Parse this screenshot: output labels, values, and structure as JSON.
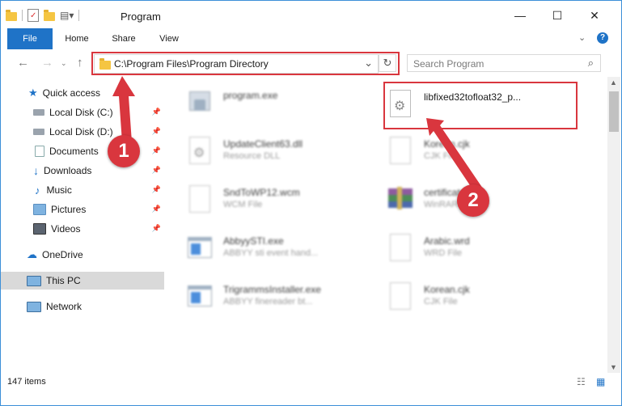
{
  "window": {
    "title": "Program"
  },
  "ribbon": {
    "tabs": [
      "File",
      "Home",
      "Share",
      "View"
    ]
  },
  "address": {
    "path": "C:\\Program Files\\Program Directory"
  },
  "search": {
    "placeholder": "Search Program"
  },
  "sidebar": {
    "items": [
      {
        "label": "Quick access",
        "icon": "star-icon"
      },
      {
        "label": "Local Disk (C:)",
        "icon": "drive-icon",
        "pinned": true
      },
      {
        "label": "Local Disk (D:)",
        "icon": "drive-icon",
        "pinned": true
      },
      {
        "label": "Documents",
        "icon": "documents-icon",
        "pinned": true
      },
      {
        "label": "Downloads",
        "icon": "downloads-icon",
        "pinned": true
      },
      {
        "label": "Music",
        "icon": "music-icon",
        "pinned": true
      },
      {
        "label": "Pictures",
        "icon": "pictures-icon",
        "pinned": true
      },
      {
        "label": "Videos",
        "icon": "videos-icon",
        "pinned": true
      },
      {
        "label": "OneDrive",
        "icon": "cloud-icon"
      },
      {
        "label": "This PC",
        "icon": "pc-icon",
        "selected": true
      },
      {
        "label": "Network",
        "icon": "network-icon"
      }
    ]
  },
  "files": [
    {
      "name": "program.exe",
      "type": ""
    },
    {
      "name": "libfixed32tofloat32_p...",
      "type": ""
    },
    {
      "name": "UpdateClient63.dll",
      "type": "Resource DLL"
    },
    {
      "name": "Korean.cjk",
      "type": "CJK File"
    },
    {
      "name": "SndToWP12.wcm",
      "type": "WCM File"
    },
    {
      "name": "certificate.cab",
      "type": "WinRAR archive"
    },
    {
      "name": "AbbyySTI.exe",
      "type": "ABBYY sti event hand..."
    },
    {
      "name": "Arabic.wrd",
      "type": "WRD File"
    },
    {
      "name": "TrigrammsInstaller.exe",
      "type": "ABBYY finereader bt..."
    },
    {
      "name": "Korean.cjk",
      "type": "CJK File"
    }
  ],
  "status": {
    "item_count": "147 items"
  },
  "annotations": {
    "step1": "1",
    "step2": "2"
  },
  "colors": {
    "accent": "#1f73c7",
    "highlight_red": "#d9363e"
  }
}
